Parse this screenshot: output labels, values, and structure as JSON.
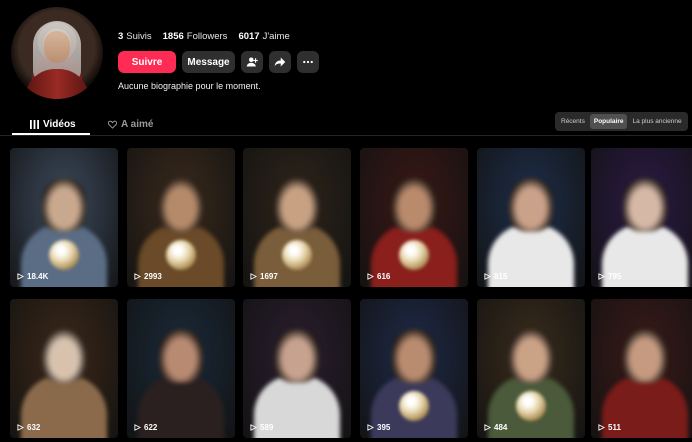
{
  "profile": {
    "stats": [
      {
        "value": "3",
        "label": "Suivis"
      },
      {
        "value": "1856",
        "label": "Followers"
      },
      {
        "value": "6017",
        "label": "J'aime"
      }
    ],
    "follow_label": "Suivre",
    "message_label": "Message",
    "bio": "Aucune biographie pour le moment."
  },
  "tabs": [
    {
      "label": "Vidéos",
      "icon": "grid-icon",
      "active": true
    },
    {
      "label": "A aimé",
      "icon": "heart-lock-icon",
      "active": false
    }
  ],
  "sort": [
    "Récents",
    "Populaire",
    "La plus ancienne"
  ],
  "sort_active": "Populaire",
  "colors": {
    "accent": "#fe2c55",
    "background": "#000000"
  },
  "videos": [
    {
      "views": "18.4K",
      "bg": "#3c4a5c",
      "fig": "#c9a98e",
      "body": "#5a6d85",
      "orb": true
    },
    {
      "views": "2993",
      "bg": "#3a2a1c",
      "fig": "#b48a6a",
      "body": "#6a4a28",
      "orb": true
    },
    {
      "views": "1697",
      "bg": "#2e241a",
      "fig": "#c7a182",
      "body": "#7a5d3a",
      "orb": true
    },
    {
      "views": "616",
      "bg": "#3a1816",
      "fig": "#b98a6c",
      "body": "#8a1f1c",
      "orb": true
    },
    {
      "views": "815",
      "bg": "#1e2e4a",
      "fig": "#caa28a",
      "body": "#e8e8e8",
      "orb": false
    },
    {
      "views": "795",
      "bg": "#2b1a45",
      "fig": "#d6b8a6",
      "body": "#e8e8e8",
      "orb": false
    },
    {
      "views": "632",
      "bg": "#3c2818",
      "fig": "#d8c2ae",
      "body": "#8a6a4a",
      "orb": false
    },
    {
      "views": "622",
      "bg": "#1a2a3a",
      "fig": "#b88a72",
      "body": "#2a2020",
      "orb": false
    },
    {
      "views": "589",
      "bg": "#2a1e2e",
      "fig": "#c7a28e",
      "body": "#d8d8d8",
      "orb": false
    },
    {
      "views": "395",
      "bg": "#1e2a48",
      "fig": "#b98c70",
      "body": "#3c3a5a",
      "orb": true
    },
    {
      "views": "484",
      "bg": "#3a2c1c",
      "fig": "#caa286",
      "body": "#4a5a3a",
      "orb": true
    },
    {
      "views": "511",
      "bg": "#3a1a18",
      "fig": "#c59a80",
      "body": "#7a1c1a",
      "orb": false
    }
  ]
}
